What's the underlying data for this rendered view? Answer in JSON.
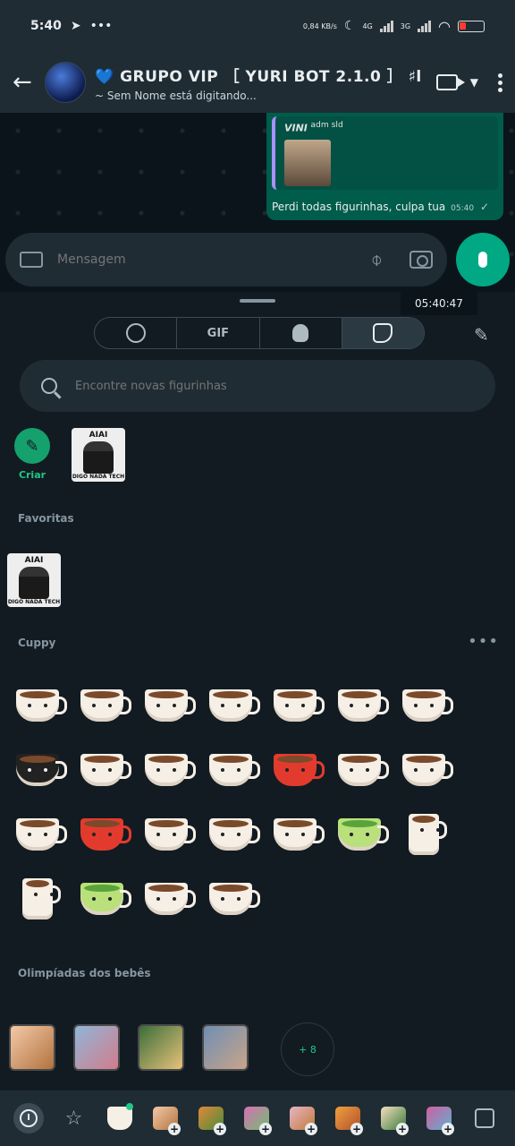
{
  "status_bar": {
    "time": "5:40",
    "net_speed": "0,84 KB/s",
    "net_4g": "4G",
    "net_3g": "3G"
  },
  "header": {
    "title": "💙 GRUPO VIP ［ YURI BOT 2.1.0 ］ ♯l",
    "subtitle": "~ Sem Nome está digitando..."
  },
  "chat": {
    "quote_name": "VINI",
    "quote_tag": "adm sld",
    "message": "Perdi todas figurinhas, culpa tua",
    "message_time": "05:40",
    "input_placeholder": "Mensagem",
    "timestamp_overlay": "05:40:47"
  },
  "panel": {
    "tabs": [
      {
        "id": "emoji",
        "label": "",
        "icon": "smile-icon"
      },
      {
        "id": "gif",
        "label": "GIF",
        "icon": ""
      },
      {
        "id": "avatar",
        "label": "",
        "icon": "avatar-icon"
      },
      {
        "id": "stickers",
        "label": "",
        "icon": "sticker-icon",
        "active": true
      }
    ],
    "search_placeholder": "Encontre novas figurinhas",
    "criar_label": "Criar",
    "sticker_caption": "AIAI",
    "sticker_sub": "DIGO NADA TECH",
    "sections": {
      "favoritas": "Favoritas",
      "cuppy": "Cuppy",
      "olimpiadas": "Olimpíadas dos bebês"
    },
    "more_label": "•••",
    "more_count": "+ 8"
  },
  "colors": {
    "accent": "#00a884",
    "bubble": "#005c4b",
    "panel_bg": "#121b22",
    "tray_bg": "#1f2c34"
  }
}
